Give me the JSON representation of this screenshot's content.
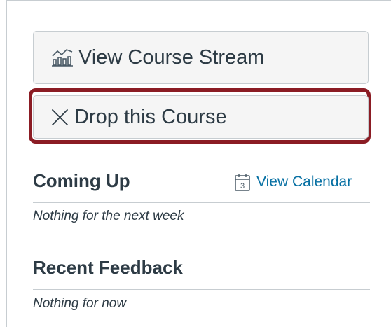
{
  "actions": {
    "view_stream_label": "View Course Stream",
    "view_stream_icon": "stream-chart-icon",
    "drop_course_label": "Drop this Course",
    "drop_course_icon": "close-icon",
    "highlight_color": "#8b1c24"
  },
  "coming_up": {
    "title": "Coming Up",
    "calendar_link_label": "View Calendar",
    "calendar_icon": "calendar-icon",
    "calendar_icon_day": "3",
    "empty_message": "Nothing for the next week"
  },
  "recent_feedback": {
    "title": "Recent Feedback",
    "empty_message": "Nothing for now"
  },
  "colors": {
    "text": "#2d3b45",
    "link": "#0770a3",
    "button_bg": "#f5f5f5",
    "border": "#c7cdd1"
  }
}
